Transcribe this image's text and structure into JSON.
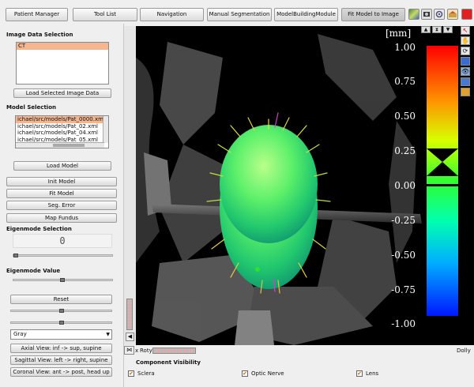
{
  "toolbar": {
    "buttons": [
      "Patient Manager",
      "Tool List",
      "Navigation",
      "Manual Segmentation",
      "ModelBuildingModule",
      "Fit Model to Image"
    ],
    "active": "Fit Model to Image"
  },
  "left": {
    "image_data_title": "Image Data Selection",
    "image_list": [
      "CT"
    ],
    "load_image_button": "Load Selected Image Data",
    "model_selection_title": "Model Selection",
    "model_list": [
      "ichael/src/models/Pat_0000.xml",
      "ichael/src/models/Pat_02.xml",
      "ichael/src/models/Pat_04.xml",
      "ichael/src/models/Pat_05.xml"
    ],
    "load_model_button": "Load Model",
    "init_model_button": "Init Model",
    "fit_model_button": "Fit Model",
    "seg_error_button": "Seg. Error",
    "map_fundus_button": "Map Fundus",
    "eigenmode_selection_title": "Eigenmode Selection",
    "eigenmode_value_display": "0",
    "eigenmode_value_title": "Eigenmode Value",
    "reset_button": "Reset",
    "colormap_select": "Gray",
    "axial_view_button": "Axial View: inf -> sup, supine",
    "sagittal_view_button": "Sagittal View: left -> right, supine",
    "coronal_view_button": "Coronal View: ant -> post, head up"
  },
  "viewer": {
    "unit_label": "[mm]",
    "colorbar_ticks": [
      "1.00",
      "0.75",
      "0.50",
      "0.25",
      "0.00",
      "-0.25",
      "-0.50",
      "-0.75",
      "-1.00"
    ],
    "roty_label": "Roty",
    "dolly_label": "Dolly",
    "x_label": "x"
  },
  "component_visibility": {
    "title": "Component Visibility",
    "items": [
      {
        "label": "Sclera",
        "checked": true
      },
      {
        "label": "Optic Nerve",
        "checked": true
      },
      {
        "label": "Lens",
        "checked": true
      }
    ]
  }
}
